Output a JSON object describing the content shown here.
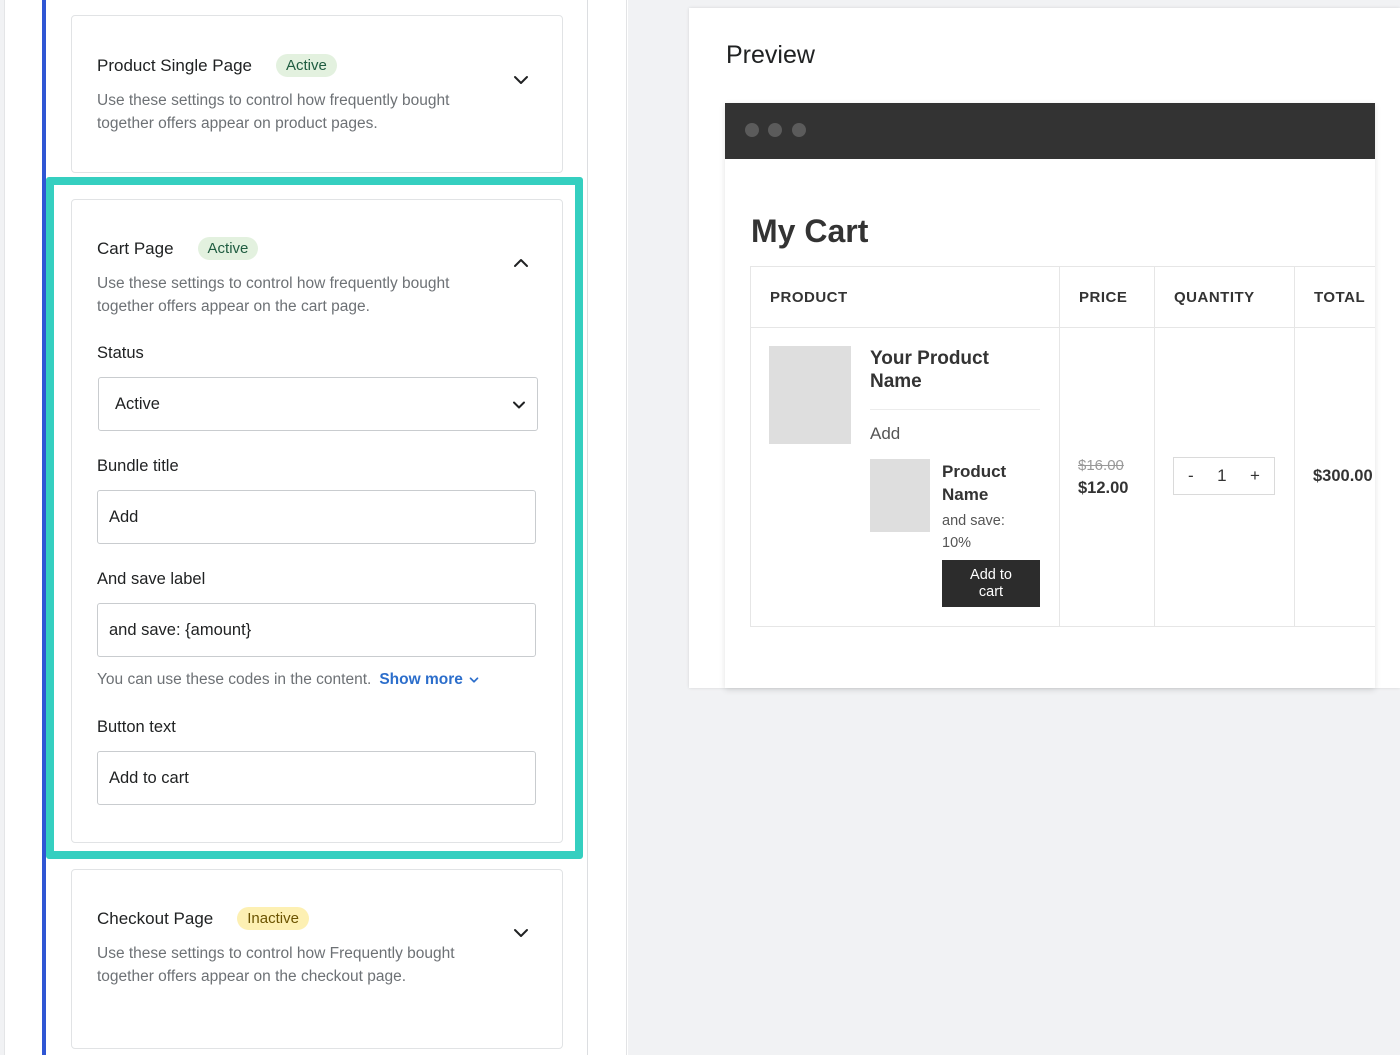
{
  "settings": {
    "product_single": {
      "title": "Product Single Page",
      "badge": "Active",
      "description": "Use these settings to control how frequently bought together offers appear on product pages."
    },
    "cart": {
      "title": "Cart Page",
      "badge": "Active",
      "description": "Use these settings to control how frequently bought together offers appear on the cart page.",
      "status_label": "Status",
      "status_value": "Active",
      "bundle_title_label": "Bundle title",
      "bundle_title_value": "Add",
      "save_label_label": "And save label",
      "save_label_value": "and save: {amount}",
      "codes_help": "You can use these codes in the content.",
      "show_more": "Show more",
      "button_text_label": "Button text",
      "button_text_value": "Add to cart"
    },
    "checkout": {
      "title": "Checkout Page",
      "badge": "Inactive",
      "description": "Use these settings to control how Frequently bought together offers appear on the checkout page."
    }
  },
  "preview": {
    "title": "Preview",
    "cart_title": "My Cart",
    "columns": [
      "PRODUCT",
      "PRICE",
      "QUANTITY",
      "TOTAL"
    ],
    "product_name": "Your Product Name",
    "bundle_title": "Add",
    "bundle_product_name": "Product Name",
    "bundle_save_text": "and save: 10%",
    "bundle_button": "Add to cart",
    "old_price": "$16.00",
    "new_price": "$12.00",
    "qty_minus": "-",
    "qty_value": "1",
    "qty_plus": "+",
    "total": "$300.00"
  },
  "colors": {
    "highlight": "#35cfc0",
    "accent_blue": "#2f56d4",
    "link": "#2c6ecb",
    "badge_active_bg": "#e3f1df",
    "badge_inactive_bg": "#fdf0b3",
    "browser_bar": "#333333"
  }
}
